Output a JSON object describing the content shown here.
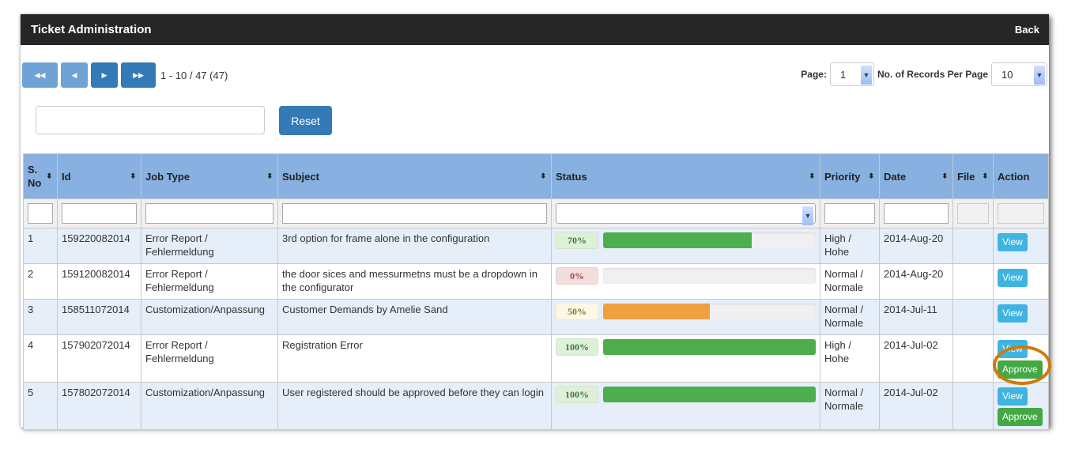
{
  "header": {
    "title": "Ticket Administration",
    "back_label": "Back"
  },
  "pager": {
    "first": "◀◀",
    "prev": "◀",
    "next": "▶",
    "last": "▶▶",
    "range_text": "1 - 10 / 47 (47)",
    "page_label": "Page:",
    "page_value": "1",
    "records_label": "No. of Records Per Page",
    "records_value": "10"
  },
  "search": {
    "value": "",
    "reset_label": "Reset"
  },
  "table": {
    "columns": [
      "S. No",
      "Id",
      "Job Type",
      "Subject",
      "Status",
      "Priority",
      "Date",
      "File",
      "Action"
    ],
    "rows": [
      {
        "sno": "1",
        "id": "159220082014",
        "job": "Error Report / Fehlermeldung",
        "subject": "3rd option for frame alone in the configuration",
        "progress": 70,
        "progress_label": "70%",
        "priority": "High / Hohe",
        "date": "2014-Aug-20",
        "view": "View",
        "approve": null
      },
      {
        "sno": "2",
        "id": "159120082014",
        "job": "Error Report / Fehlermeldung",
        "subject": "the door sices and messurmetns must be a dropdown in the configurator",
        "progress": 0,
        "progress_label": "0%",
        "priority": "Normal / Normale",
        "date": "2014-Aug-20",
        "view": "View",
        "approve": null
      },
      {
        "sno": "3",
        "id": "158511072014",
        "job": "Customization/Anpassung",
        "subject": "Customer Demands by Amelie Sand",
        "progress": 50,
        "progress_label": "50%",
        "priority": "Normal / Normale",
        "date": "2014-Jul-11",
        "view": "View",
        "approve": null
      },
      {
        "sno": "4",
        "id": "157902072014",
        "job": "Error Report / Fehlermeldung",
        "subject": "Registration Error",
        "progress": 100,
        "progress_label": "100%",
        "priority": "High / Hohe",
        "date": "2014-Jul-02",
        "view": "View",
        "approve": "Approve"
      },
      {
        "sno": "5",
        "id": "157802072014",
        "job": "Customization/Anpassung",
        "subject": "User registered should be approved before they can login",
        "progress": 100,
        "progress_label": "100%",
        "priority": "Normal / Normale",
        "date": "2014-Jul-02",
        "view": "View",
        "approve": "Approve"
      }
    ]
  },
  "colors": {
    "header_bg": "#262626",
    "table_header": "#88b0e0",
    "primary": "#337ab7",
    "success": "#4cae4c",
    "warning": "#f0a040",
    "info": "#3fb4e0",
    "highlight": "#d07a0c"
  }
}
